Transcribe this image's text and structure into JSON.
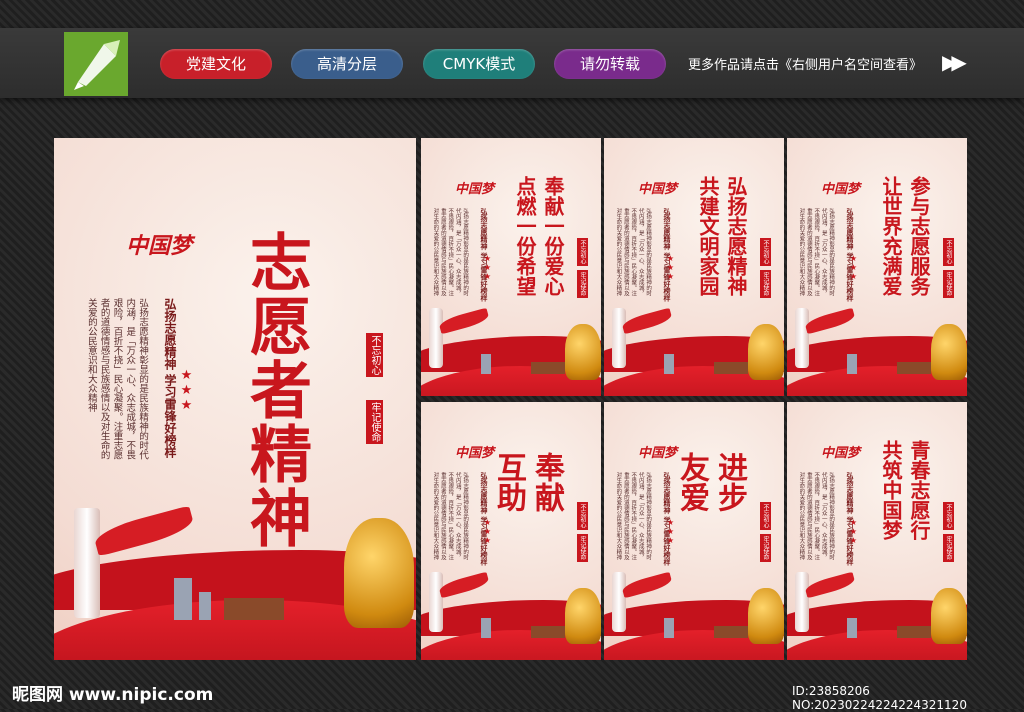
{
  "topbar": {
    "pills": [
      {
        "label": "党建文化",
        "color": "#c8202a"
      },
      {
        "label": "高清分层",
        "color": "#3a5e8c"
      },
      {
        "label": "CMYK模式",
        "color": "#1f7f7a"
      },
      {
        "label": "请勿转载",
        "color": "#7a2b8c"
      }
    ],
    "note": "更多作品请点击《右侧用户名空间查看》",
    "arrows": "▶▶"
  },
  "main_poster": {
    "title": "志愿者精神",
    "subtitle": "弘扬志愿精神  学习雷锋好榜样",
    "body": "弘扬志愿精神彰显的是民族精神的时代内涵，是「万众一心、众志成城，不畏艰险，百折不挠」民心凝聚。注重志愿者的道德情感与民族感情以及对生命的关爱的公民意识和大众精神",
    "seal_left": "不忘初心",
    "seal_right": "牢记使命",
    "logo_text": "中国梦",
    "stars": "★★★"
  },
  "small_posters": [
    {
      "title_lines": [
        "奉献一份爱心",
        "点燃一份希望"
      ]
    },
    {
      "title_lines": [
        "弘扬志愿精神",
        "共建文明家园"
      ]
    },
    {
      "title_lines": [
        "参与志愿服务",
        "让世界充满爱"
      ]
    },
    {
      "title_lines": [
        "奉献",
        "互助"
      ]
    },
    {
      "title_lines": [
        "进步",
        "友爱"
      ]
    },
    {
      "title_lines": [
        "青春志愿行",
        "共筑中国梦"
      ]
    }
  ],
  "footer": {
    "site": "昵图网 www.nipic.com",
    "id": "ID:23858206 NO:20230224224224321120"
  },
  "colors": {
    "accent": "#c8161d",
    "gold": "#e0a020"
  }
}
